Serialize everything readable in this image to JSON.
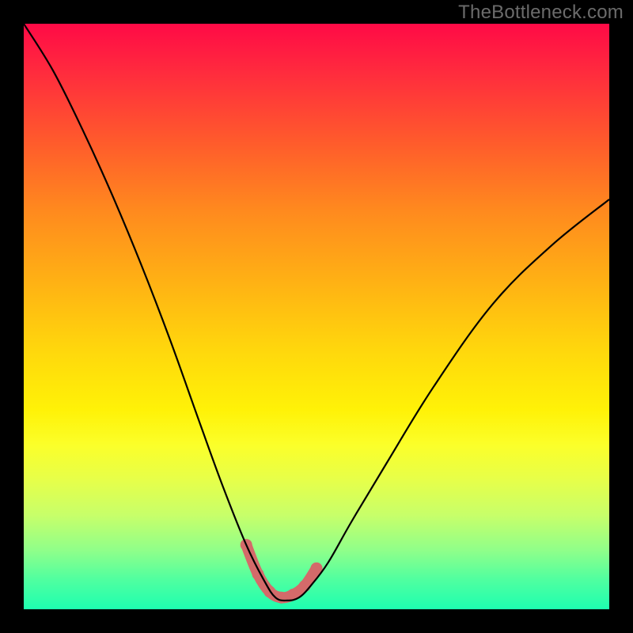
{
  "watermark": "TheBottleneck.com",
  "colors": {
    "frame": "#000000",
    "curve": "#000000",
    "valley_highlight": "#d46a6a",
    "gradient_top": "#ff0a46",
    "gradient_bottom": "#1effb0"
  },
  "chart_data": {
    "type": "line",
    "title": "",
    "xlabel": "",
    "ylabel": "",
    "xlim": [
      0,
      100
    ],
    "ylim": [
      0,
      100
    ],
    "grid": false,
    "legend": false,
    "note": "Background is a vertical red→yellow→green gradient; y≈0 at bottom (green = good), y≈100 at top (red = bad). Curve is a V-shaped bottleneck profile with minimum near x≈42–48, y≈2; a salmon highlight marks the valley floor.",
    "series": [
      {
        "name": "bottleneck-curve",
        "x": [
          0,
          5,
          10,
          15,
          20,
          25,
          30,
          34,
          38,
          41,
          43,
          45,
          47,
          49,
          52,
          56,
          62,
          70,
          80,
          90,
          100
        ],
        "y": [
          100,
          92,
          82,
          71,
          59,
          46,
          32,
          21,
          11,
          5,
          2,
          1.5,
          2,
          4,
          8,
          15,
          25,
          38,
          52,
          62,
          70
        ]
      },
      {
        "name": "valley-highlight",
        "x": [
          38,
          40,
          42,
          44,
          46,
          48,
          50
        ],
        "y": [
          11,
          6,
          3,
          2,
          2.5,
          4,
          7
        ]
      }
    ]
  }
}
